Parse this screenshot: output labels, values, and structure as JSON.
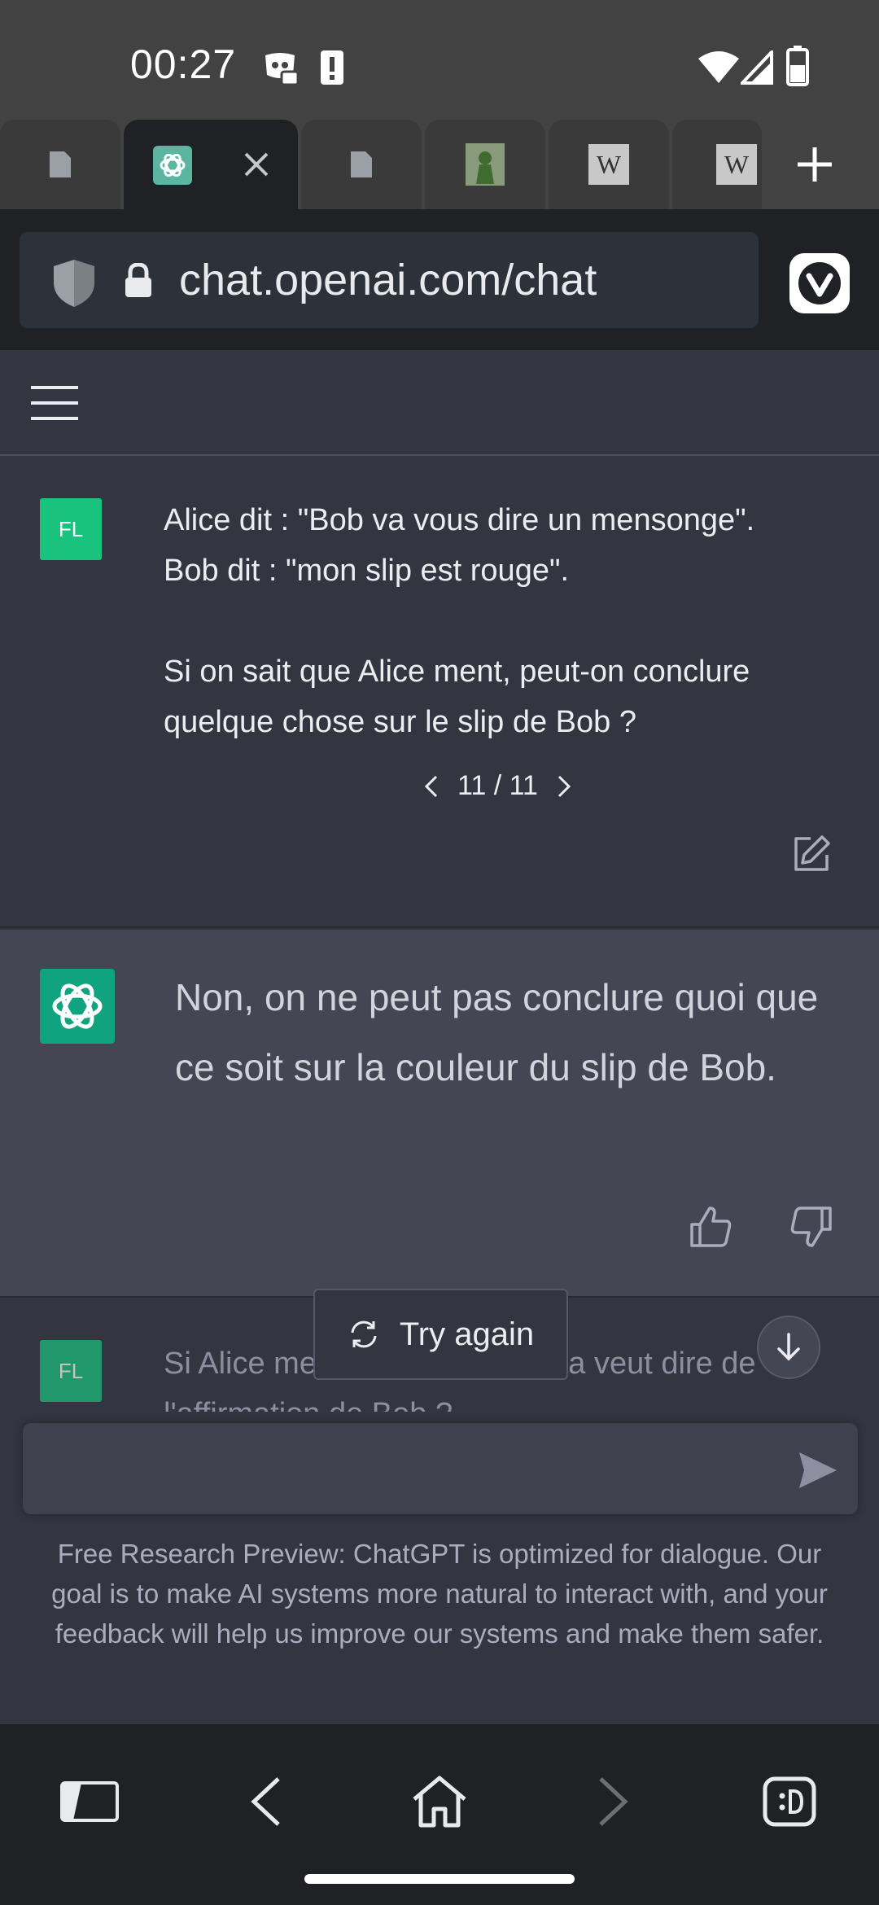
{
  "status_bar": {
    "time": "00:27"
  },
  "browser": {
    "url": "chat.openai.com/chat",
    "tabs": [
      {
        "favicon": "document-icon"
      },
      {
        "favicon": "chatgpt-icon",
        "active": true
      },
      {
        "favicon": "document-icon"
      },
      {
        "favicon": "chess-icon"
      },
      {
        "favicon": "wikipedia-icon",
        "label": "W"
      },
      {
        "favicon": "wikipedia-icon",
        "label": "W"
      }
    ]
  },
  "chat": {
    "user_avatar": "FL",
    "user_message": "Alice dit : \"Bob va vous dire un mensonge\".\nBob dit : \"mon slip est rouge\".\n\nSi on sait que Alice ment, peut-on conclure quelque chose sur le slip de Bob ?",
    "pager": "11 / 11",
    "assistant_message": "Non, on ne peut pas conclure quoi que ce soit sur la couleur du slip de Bob.",
    "next_user_message": "Si Alice ment, qu'est-ce que ça veut dire de l'affirmation de Bob ?",
    "try_again_label": "Try again",
    "input_placeholder": "",
    "disclaimer": "Free Research Preview: ChatGPT is optimized for dialogue. Our goal is to make AI systems more natural to interact with, and your feedback will help us improve our systems and make them safer."
  },
  "colors": {
    "chat_bg": "#343541",
    "assistant_bg": "#444654",
    "user_avatar": "#19c37d",
    "assistant_avatar": "#10a37f"
  }
}
